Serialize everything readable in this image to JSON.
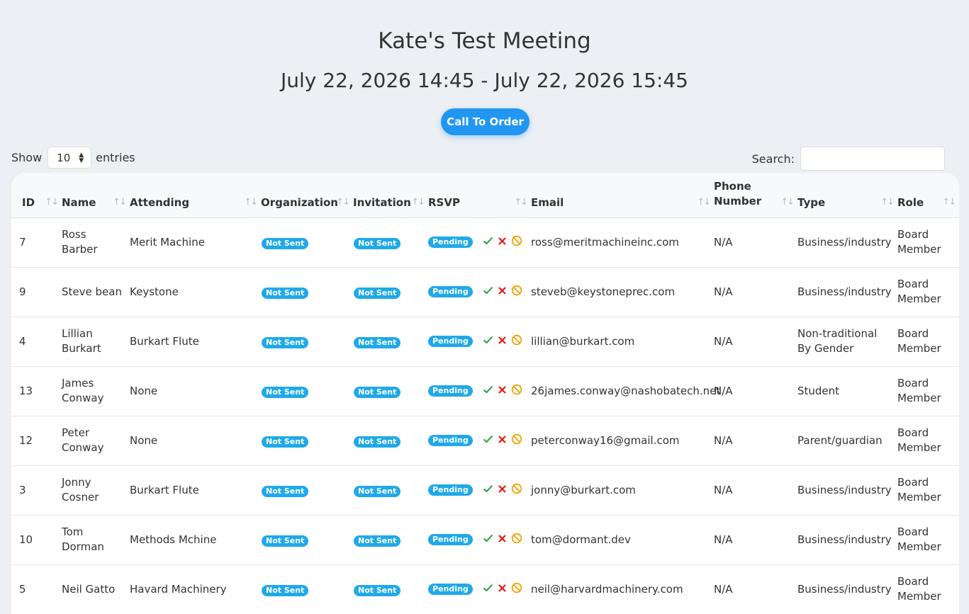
{
  "meeting": {
    "title": "Kate's Test Meeting",
    "datetime": "July 22, 2026 14:45 - July 22, 2026 15:45",
    "call_button": "Call To Order"
  },
  "controls": {
    "show_label": "Show",
    "entries_value": "10",
    "entries_label": "entries",
    "search_label": "Search:",
    "search_value": ""
  },
  "table": {
    "columns": [
      "ID",
      "Name",
      "Attending",
      "Organization",
      "Invitation",
      "RSVP",
      "Email",
      "Phone Number",
      "Type",
      "Role"
    ],
    "rows": [
      {
        "id": "7",
        "name": "Ross Barber",
        "attending": "Merit Machine",
        "organization": "Not Sent",
        "invitation": "Not Sent",
        "rsvp": "Pending",
        "email": "ross@meritmachineinc.com",
        "phone": "N/A",
        "type": "Business/industry",
        "role": "Board Member"
      },
      {
        "id": "9",
        "name": "Steve bean",
        "attending": "Keystone",
        "organization": "Not Sent",
        "invitation": "Not Sent",
        "rsvp": "Pending",
        "email": "steveb@keystoneprec.com",
        "phone": "N/A",
        "type": "Business/industry",
        "role": "Board Member"
      },
      {
        "id": "4",
        "name": "Lillian Burkart",
        "attending": "Burkart Flute",
        "organization": "Not Sent",
        "invitation": "Not Sent",
        "rsvp": "Pending",
        "email": "lillian@burkart.com",
        "phone": "N/A",
        "type": "Non-traditional By Gender",
        "role": "Board Member"
      },
      {
        "id": "13",
        "name": "James Conway",
        "attending": "None",
        "organization": "Not Sent",
        "invitation": "Not Sent",
        "rsvp": "Pending",
        "email": "26james.conway@nashobatech.net",
        "phone": "N/A",
        "type": "Student",
        "role": "Board Member"
      },
      {
        "id": "12",
        "name": "Peter Conway",
        "attending": "None",
        "organization": "Not Sent",
        "invitation": "Not Sent",
        "rsvp": "Pending",
        "email": "peterconway16@gmail.com",
        "phone": "N/A",
        "type": "Parent/guardian",
        "role": "Board Member"
      },
      {
        "id": "3",
        "name": "Jonny Cosner",
        "attending": "Burkart Flute",
        "organization": "Not Sent",
        "invitation": "Not Sent",
        "rsvp": "Pending",
        "email": "jonny@burkart.com",
        "phone": "N/A",
        "type": "Business/industry",
        "role": "Board Member"
      },
      {
        "id": "10",
        "name": "Tom Dorman",
        "attending": "Methods Mchine",
        "organization": "Not Sent",
        "invitation": "Not Sent",
        "rsvp": "Pending",
        "email": "tom@dormant.dev",
        "phone": "N/A",
        "type": "Business/industry",
        "role": "Board Member"
      },
      {
        "id": "5",
        "name": "Neil Gatto",
        "attending": "Havard Machinery",
        "organization": "Not Sent",
        "invitation": "Not Sent",
        "rsvp": "Pending",
        "email": "neil@harvardmachinery.com",
        "phone": "N/A",
        "type": "Business/industry",
        "role": "Board Member"
      }
    ]
  },
  "icons": {
    "accept": "check-icon",
    "decline": "x-icon",
    "block": "ban-icon",
    "sort": "sort-arrows-icon",
    "dropdown": "updown-caret-icon"
  },
  "colors": {
    "page_background": "#eceff4",
    "primary_button": "#2196f3",
    "badge": "#1fa9e9",
    "accept": "#21a336",
    "decline": "#e81414",
    "block": "#f5a100"
  }
}
